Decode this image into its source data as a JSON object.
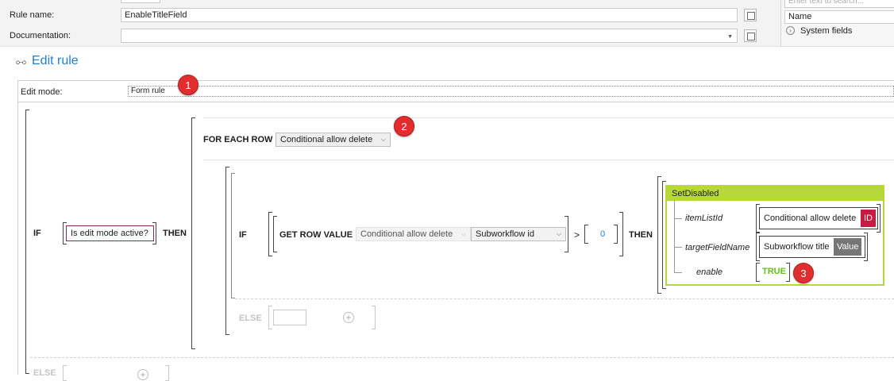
{
  "background_form": {
    "rule_name_label": "Rule name:",
    "rule_name_value": "EnableTitleField",
    "documentation_label": "Documentation:",
    "search_placeholder": "Enter text to search...",
    "name_header": "Name",
    "system_fields": "System fields"
  },
  "dialog": {
    "title": "Edit rule",
    "edit_mode_label": "Edit mode:",
    "edit_mode_value": "Form rule"
  },
  "rule": {
    "if_kw": "IF",
    "condition": "Is edit mode active?",
    "then_kw": "THEN",
    "for_each_kw": "FOR EACH ROW",
    "for_each_list": "Conditional allow delete",
    "inner_if_kw": "IF",
    "get_row_value_kw": "GET ROW VALUE",
    "row_list": "Conditional allow delete",
    "row_field": "Subworkflow id",
    "operator": ">",
    "compare_value": "0",
    "inner_then_kw": "THEN",
    "inner_else_kw": "ELSE",
    "outer_else_kw": "ELSE"
  },
  "action": {
    "name": "SetDisabled",
    "params": [
      {
        "name": "itemListId",
        "value": "Conditional allow delete",
        "tag": "ID"
      },
      {
        "name": "targetFieldName",
        "value": "Subworkflow title",
        "tag": "Value"
      },
      {
        "name": "enable",
        "value": "TRUE"
      }
    ]
  },
  "callouts": [
    "1",
    "2",
    "3"
  ],
  "colors": {
    "accent": "#1f7fcf",
    "action_header": "#b6d83b",
    "id_tag": "#c61c42",
    "value_tag": "#767676",
    "true_text": "#62c217",
    "badge": "#e02d2d"
  }
}
